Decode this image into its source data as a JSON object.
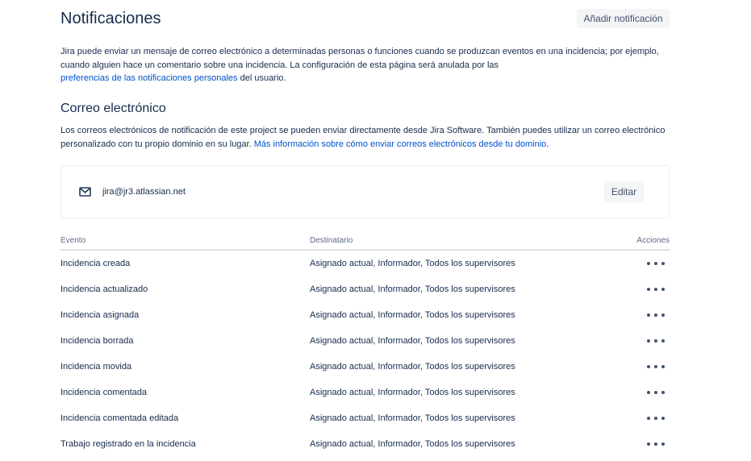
{
  "header": {
    "title": "Notificaciones",
    "add_button": "Añadir notificación"
  },
  "intro": {
    "text": "Jira puede enviar un mensaje de correo electrónico a determinadas personas o funciones cuando se produzcan eventos en una incidencia; por ejemplo, cuando alguien hace un comentario sobre una incidencia. La configuración de esta página será anulada por las",
    "link": "preferencias de las notificaciones personales",
    "suffix": "del usuario."
  },
  "email_section": {
    "title": "Correo electrónico",
    "text": "Los correos electrónicos de notificación de este project se pueden enviar directamente desde Jira Software. También puedes utilizar un correo electrónico personalizado con tu propio dominio en su lugar.",
    "link": "Más información sobre cómo enviar correos electrónicos desde tu dominio",
    "link_suffix": ".",
    "address": "jira@jr3.atlassian.net",
    "edit_button": "Editar",
    "icon": "mail-icon"
  },
  "table": {
    "headers": {
      "event": "Evento",
      "recipient": "Destinatario",
      "actions": "Acciones"
    },
    "rows": [
      {
        "event": "Incidencia creada",
        "recipient": "Asignado actual, Informador, Todos los supervisores"
      },
      {
        "event": "Incidencia actualizado",
        "recipient": "Asignado actual, Informador, Todos los supervisores"
      },
      {
        "event": "Incidencia asignada",
        "recipient": "Asignado actual, Informador, Todos los supervisores"
      },
      {
        "event": "Incidencia borrada",
        "recipient": "Asignado actual, Informador, Todos los supervisores"
      },
      {
        "event": "Incidencia movida",
        "recipient": "Asignado actual, Informador, Todos los supervisores"
      },
      {
        "event": "Incidencia comentada",
        "recipient": "Asignado actual, Informador, Todos los supervisores"
      },
      {
        "event": "Incidencia comentada editada",
        "recipient": "Asignado actual, Informador, Todos los supervisores"
      },
      {
        "event": "Trabajo registrado en la incidencia",
        "recipient": "Asignado actual, Informador, Todos los supervisores"
      }
    ]
  },
  "colors": {
    "link": "#0052cc",
    "text": "#172b4d",
    "button_bg": "#f4f5f7"
  }
}
